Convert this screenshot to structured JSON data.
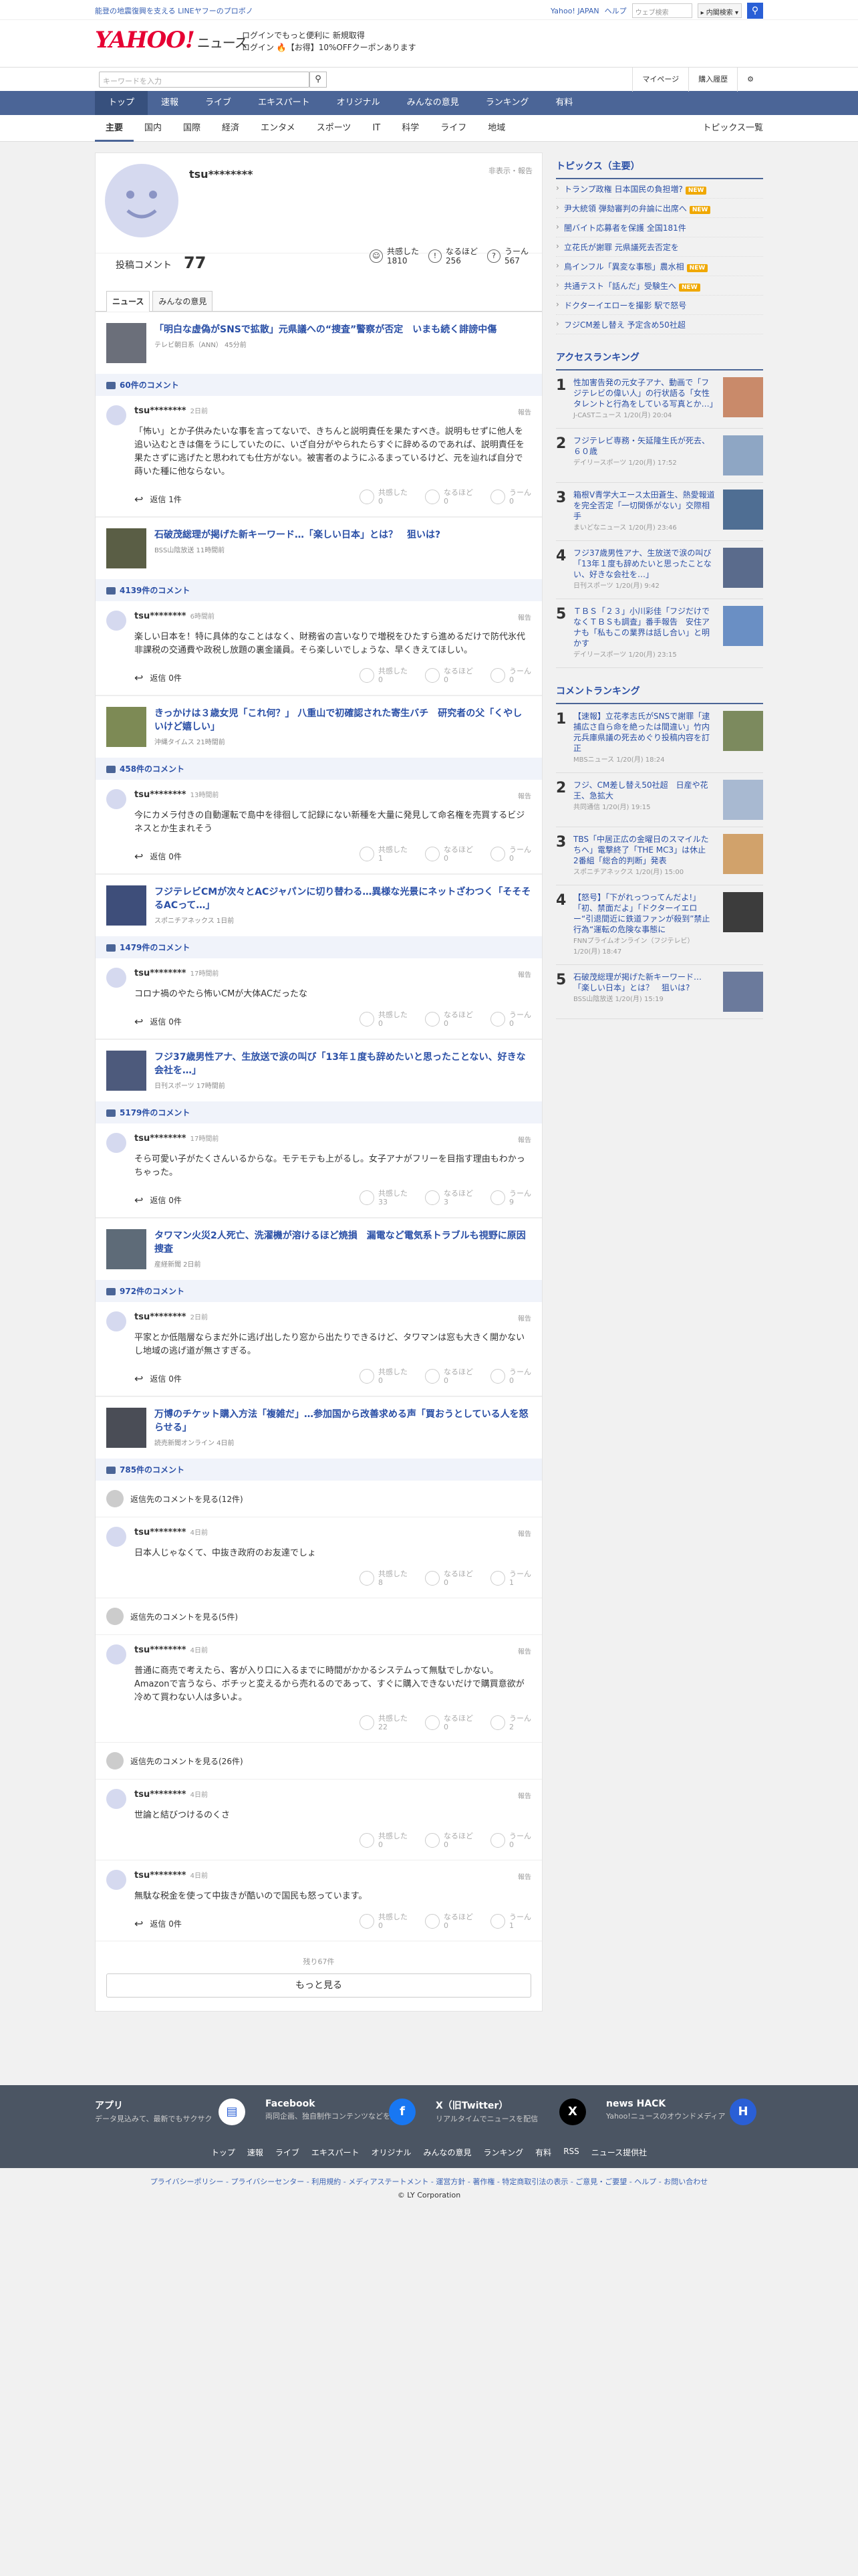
{
  "top": {
    "promo": "能登の地震復興を支える LINEヤフーのプロボノ",
    "links": [
      "Yahoo! JAPAN",
      "ヘルプ"
    ],
    "search_placeholder": "ウェブ検索",
    "search_scope": "▸ 内閣検索 ▾"
  },
  "header": {
    "logo": "YAHOO! JAPAN",
    "logo_sub": "ニュース",
    "msg1": "ログインでもっと便利に 新規取得",
    "msg2": "ログイン 🔥【お得】10%OFFクーポンあります"
  },
  "toolbar": {
    "keyword_placeholder": "キーワードを入力",
    "mypage": "マイページ",
    "history": "購入履歴"
  },
  "gnav": [
    "トップ",
    "速報",
    "ライブ",
    "エキスパート",
    "オリジナル",
    "みんなの意見",
    "ランキング",
    "有料"
  ],
  "subnav": [
    "主要",
    "国内",
    "国際",
    "経済",
    "エンタメ",
    "スポーツ",
    "IT",
    "科学",
    "ライフ",
    "地域"
  ],
  "subnav_right": "トピックス一覧",
  "profile": {
    "username": "tsu********",
    "hide_report": "非表示・報告",
    "count_label": "投稿コメント",
    "count": "77",
    "reactions": [
      {
        "label": "共感した",
        "value": "1810",
        "icon": "☺"
      },
      {
        "label": "なるほど",
        "value": "256",
        "icon": "!"
      },
      {
        "label": "うーん",
        "value": "567",
        "icon": "?"
      }
    ],
    "tabs": [
      "ニュース",
      "みんなの意見"
    ]
  },
  "articles": [
    {
      "title": "「明白な虚偽がSNSで拡散」元県議への“捜査”警察が否定　いまも続く誹謗中傷",
      "meta": "テレビ朝日系（ANN） 45分前",
      "comments_count": "60件のコメント",
      "comments": [
        {
          "user": "tsu********",
          "time": "2日前",
          "text": "「怖い」とか子供みたいな事を言ってないで、きちんと説明責任を果たすべき。説明もせずに他人を追い込むときは傷をうにしていたのに、いざ自分がやられたらすぐに辞めるのであれば、説明責任を果たさずに逃げたと思われても仕方がない。被害者のようにふるまっているけど、元を辿れば自分で蒔いた種に他ならない。",
          "reply": "返信 1件",
          "votes": [
            "0",
            "0",
            "0"
          ]
        }
      ]
    },
    {
      "title": "石破茂総理が掲げた新キーワード…「楽しい日本」とは？　狙いは?",
      "meta": "BSS山陰放送 11時間前",
      "comments_count": "4139件のコメント",
      "comments": [
        {
          "user": "tsu********",
          "time": "6時間前",
          "text": "楽しい日本を！特に具体的なことはなく、財務省の言いなりで増税をひたすら進めるだけで防代氷代非課税の交通費や政税し放題の裏金議員。そら楽しいでしょうな、早くきえてほしい。",
          "reply": "返信 0件",
          "votes": [
            "0",
            "0",
            "0"
          ]
        }
      ]
    },
    {
      "title": "きっかけは３歳女児「これ何？」 八重山で初確認された寄生バチ　研究者の父「くやしいけど嬉しい」",
      "meta": "沖縄タイムス 21時間前",
      "comments_count": "458件のコメント",
      "comments": [
        {
          "user": "tsu********",
          "time": "13時間前",
          "text": "今にカメラ付きの自動運転で島中を徘徊して記録にない新種を大量に発見して命名権を売買するビジネスとか生まれそう",
          "reply": "返信 0件",
          "votes": [
            "1",
            "0",
            "0"
          ]
        }
      ]
    },
    {
      "title": "フジテレビCMが次々とACジャパンに切り替わる…異様な光景にネットざわつく「そそそるACって…」",
      "meta": "スポニチアネックス 1日前",
      "comments_count": "1479件のコメント",
      "comments": [
        {
          "user": "tsu********",
          "time": "17時間前",
          "text": "コロナ禍のやたら怖いCMが大体ACだったな",
          "reply": "返信 0件",
          "votes": [
            "0",
            "0",
            "0"
          ]
        }
      ]
    },
    {
      "title": "フジ37歳男性アナ、生放送で涙の叫び「13年１度も辞めたいと思ったことない、好きな会社を…」",
      "meta": "日刊スポーツ 17時間前",
      "comments_count": "5179件のコメント",
      "comments": [
        {
          "user": "tsu********",
          "time": "17時間前",
          "text": "そら可愛い子がたくさんいるからな。モテモテも上がるし。女子アナがフリーを目指す理由もわかっちゃった。",
          "reply": "返信 0件",
          "votes": [
            "33",
            "3",
            "9"
          ]
        }
      ]
    },
    {
      "title": "タワマン火災2人死亡、洗濯機が溶けるほど焼損　漏電など電気系トラブルも視野に原因捜査",
      "meta": "産経新聞 2日前",
      "comments_count": "972件のコメント",
      "comments": [
        {
          "user": "tsu********",
          "time": "2日前",
          "text": "平家とか低階層ならまだ外に逃げ出したり窓から出たりできるけど、タワマンは窓も大きく開かないし地域の逃げ道が無さすぎる。",
          "reply": "返信 0件",
          "votes": [
            "0",
            "0",
            "0"
          ]
        }
      ]
    },
    {
      "title": "万博のチケット購入方法「複雑だ」…参加国から改善求める声「買おうとしている人を怒らせる」",
      "meta": "読売新聞オンライン 4日前",
      "comments_count": "785件のコメント",
      "comments": [
        {
          "more": "返信先のコメントを見る(12件)"
        },
        {
          "user": "tsu********",
          "time": "4日前",
          "text": "日本人じゃなくて、中抜き政府のお友達でしょ",
          "reply": "",
          "votes": [
            "8",
            "0",
            "1"
          ]
        },
        {
          "more": "返信先のコメントを見る(5件)"
        },
        {
          "user": "tsu********",
          "time": "4日前",
          "text": "普通に商売で考えたら、客が入り口に入るまでに時間がかかるシステムって無駄でしかない。Amazonで言うなら、ボチッと変えるから売れるのであって、すぐに購入できないだけで購買意欲が冷めて買わない人は多いよ。",
          "reply": "",
          "votes": [
            "22",
            "0",
            "2"
          ]
        },
        {
          "more": "返信先のコメントを見る(26件)"
        },
        {
          "user": "tsu********",
          "time": "4日前",
          "text": "世論と結びつけるのくさ",
          "reply": "",
          "votes": [
            "0",
            "0",
            "0"
          ]
        },
        {
          "user": "tsu********",
          "time": "4日前",
          "text": "無駄な税金を使って中抜きが酷いので国民も怒っています。",
          "reply": "返信 0件",
          "votes": [
            "0",
            "0",
            "1"
          ]
        }
      ]
    }
  ],
  "vote_labels": [
    "共感した",
    "なるほど",
    "うーん"
  ],
  "report_label": "報告",
  "remain": "残り67件",
  "more_button": "もっと見る",
  "sidebar": {
    "topics_title": "トピックス（主要）",
    "topics": [
      {
        "text": "トランプ政権 日本国民の負担増?",
        "new": true
      },
      {
        "text": "尹大統領 弾劾審判の弁論に出席へ",
        "new": true
      },
      {
        "text": "闇バイト応募者を保護 全国181件",
        "new": false
      },
      {
        "text": "立花氏が謝罪 元県議死去否定を",
        "new": false
      },
      {
        "text": "鳥インフル「異変な事態」農水相",
        "new": true
      },
      {
        "text": "共通テスト「話んだ」受験生へ",
        "new": true
      },
      {
        "text": "ドクターイエローを撮影 駅で怒号",
        "new": false
      },
      {
        "text": "フジCM差し替え 予定含め50社超",
        "new": false
      }
    ],
    "new_label": "NEW",
    "access_title": "アクセスランキング",
    "access": [
      {
        "n": "1",
        "t": "性加害告発の元女子アナ、動画で「フジテレビの偉い人」の行状語る「女性タレントと行為をしている写真とか…」",
        "s": "J-CASTニュース 1/20(月) 20:04"
      },
      {
        "n": "2",
        "t": "フジテレビ専務・矢延隆生氏が死去、６０歳",
        "s": "デイリースポーツ 1/20(月) 17:52"
      },
      {
        "n": "3",
        "t": "箱根V青学大エース太田蒼生、熱愛報道を完全否定「一切関係がない」交際相手",
        "s": "まいどなニュース 1/20(月) 23:46"
      },
      {
        "n": "4",
        "t": "フジ37歳男性アナ、生放送で涙の叫び「13年１度も辞めたいと思ったことない、好きな会社を…」",
        "s": "日刊スポーツ 1/20(月) 9:42"
      },
      {
        "n": "5",
        "t": "ＴＢＳ「２３」小川彩佳「フジだけでなくＴＢＳも調査」番手報告　安住アナも「私もこの業界は話し合い」と明かす",
        "s": "デイリースポーツ 1/20(月) 23:15"
      }
    ],
    "comment_title": "コメントランキング",
    "comment": [
      {
        "n": "1",
        "t": "【速報】立花孝志氏がSNSで謝罪「逮捕広さ自ら命を絶ったは間違い」竹内元兵庫県議の死去めぐり投稿内容を訂正",
        "s": "MBSニュース 1/20(月) 18:24"
      },
      {
        "n": "2",
        "t": "フジ、CM差し替え50社超　日産や花王、急拡大",
        "s": "共同通信 1/20(月) 19:15"
      },
      {
        "n": "3",
        "t": "TBS「中居正広の金曜日のスマイルたちへ」電撃終了「THE MC3」は休止　2番組「総合的判断」発表",
        "s": "スポニチアネックス 1/20(月) 15:00"
      },
      {
        "n": "4",
        "t": "【怒号】「下がれっつってんだよ!」「初、禁面だよ」「ドクターイエロー“引退間近に鉄道ファンが殺到”禁止行為“運転の危険な事態に",
        "s": "FNNプライムオンライン（フジテレビ） 1/20(月) 18:47"
      },
      {
        "n": "5",
        "t": "石破茂総理が掲げた新キーワード…「楽しい日本」とは？　狙いは?",
        "s": "BSS山陰放送 1/20(月) 15:19"
      }
    ]
  },
  "footer": {
    "items": [
      {
        "title": "アプリ",
        "desc": "データ見込みて、最新でもサクサク",
        "icon": "▤"
      },
      {
        "title": "Facebook",
        "desc": "両同企画、独自制作コンテンツなどを投稿",
        "icon": "f"
      },
      {
        "title": "X（旧Twitter）",
        "desc": "リアルタイムでニュースを配信",
        "icon": "X"
      },
      {
        "title": "news HACK",
        "desc": "Yahoo!ニュースのオウンドメディア",
        "icon": "H"
      }
    ],
    "links": [
      "トップ",
      "速報",
      "ライブ",
      "エキスパート",
      "オリジナル",
      "みんなの意見",
      "ランキング",
      "有料",
      "RSS",
      "ニュース提供社"
    ],
    "legal": "プライバシーポリシー - プライバシーセンター - 利用規約 - メディアステートメント - 運営方針 - 著作権 - 特定商取引法の表示 - ご意見・ご要望 - ヘルプ - お問い合わせ",
    "copyright": "© LY Corporation"
  }
}
